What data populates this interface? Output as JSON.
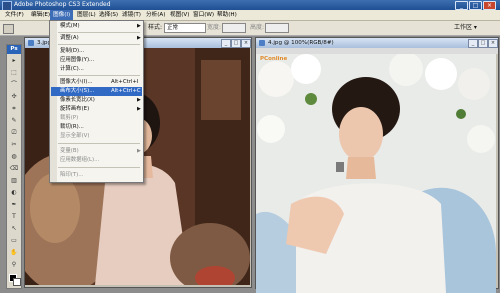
{
  "window": {
    "title": "Adobe Photoshop CS3 Extended",
    "controls": [
      "_",
      "□",
      "×"
    ]
  },
  "menubar": [
    "文件(F)",
    "编辑(E)",
    "图像(I)",
    "图层(L)",
    "选择(S)",
    "滤镜(T)",
    "分析(A)",
    "视图(V)",
    "窗口(W)",
    "帮助(H)"
  ],
  "optionsbar": {
    "style_label": "样式:",
    "style_value": "正常",
    "width_label": "宽度:",
    "height_label": "高度:",
    "workspace": "工作区 ▾"
  },
  "image_menu": [
    {
      "label": "模式(M)",
      "arrow": "▶"
    },
    {
      "sep": true
    },
    {
      "label": "调整(A)",
      "arrow": "▶"
    },
    {
      "sep": true
    },
    {
      "label": "复制(D)..."
    },
    {
      "label": "应用图像(Y)..."
    },
    {
      "label": "计算(C)..."
    },
    {
      "sep": true
    },
    {
      "label": "图像大小(I)...",
      "shortcut": "Alt+Ctrl+I"
    },
    {
      "label": "画布大小(S)...",
      "shortcut": "Alt+Ctrl+C",
      "selected": true
    },
    {
      "label": "像素长宽比(X)",
      "arrow": "▶"
    },
    {
      "label": "旋转画布(E)",
      "arrow": "▶"
    },
    {
      "label": "裁剪(P)",
      "disabled": true
    },
    {
      "label": "裁切(R)..."
    },
    {
      "label": "显示全部(V)",
      "disabled": true
    },
    {
      "sep": true
    },
    {
      "label": "变量(B)",
      "arrow": "▶",
      "disabled": true
    },
    {
      "label": "应用数据组(L)...",
      "disabled": true
    },
    {
      "sep": true
    },
    {
      "label": "陷印(T)...",
      "disabled": true
    }
  ],
  "doc_left": {
    "title": "3.jpg"
  },
  "doc_right": {
    "title": "4.jpg @ 100%(RGB/8#)",
    "watermark": "PConline"
  },
  "toolbox": {
    "logo": "Ps",
    "tools": [
      "▸",
      "⬚",
      "⌒",
      "✣",
      "⌗",
      "✎",
      "⎚",
      "✂",
      "◍",
      "⌫",
      "▥",
      "◐",
      "✒",
      "T",
      "↖",
      "▭",
      "✋",
      "⚲"
    ]
  },
  "colors": {
    "titlebar": "#1f4f94",
    "menu_highlight": "#316ac5",
    "menubar": "#ece9d8"
  }
}
